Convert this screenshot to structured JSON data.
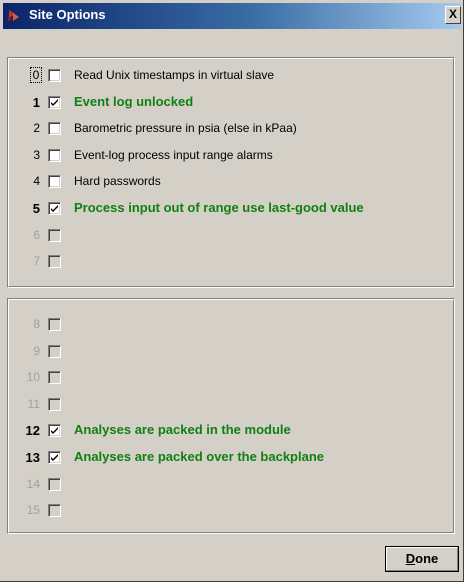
{
  "window": {
    "title": "Site Options",
    "close_label": "X"
  },
  "colors": {
    "enabled_label": "#108010",
    "disabled_number": "#a0a0a0",
    "titlebar_start": "#0a246a",
    "titlebar_end": "#a6caf0"
  },
  "options_top": [
    {
      "number": "0",
      "label": "Read Unix timestamps in virtual slave",
      "checked": false,
      "enabled": true
    },
    {
      "number": "1",
      "label": "Event log unlocked",
      "checked": true,
      "enabled": true
    },
    {
      "number": "2",
      "label": "Barometric pressure in psia (else in kPaa)",
      "checked": false,
      "enabled": true
    },
    {
      "number": "3",
      "label": "Event-log process input range alarms",
      "checked": false,
      "enabled": true
    },
    {
      "number": "4",
      "label": "Hard passwords",
      "checked": false,
      "enabled": true
    },
    {
      "number": "5",
      "label": "Process input out of range use last-good value",
      "checked": true,
      "enabled": true
    },
    {
      "number": "6",
      "label": "",
      "checked": false,
      "enabled": false
    },
    {
      "number": "7",
      "label": "",
      "checked": false,
      "enabled": false
    }
  ],
  "options_bottom": [
    {
      "number": "8",
      "label": "",
      "checked": false,
      "enabled": false
    },
    {
      "number": "9",
      "label": "",
      "checked": false,
      "enabled": false
    },
    {
      "number": "10",
      "label": "",
      "checked": false,
      "enabled": false
    },
    {
      "number": "11",
      "label": "",
      "checked": false,
      "enabled": false
    },
    {
      "number": "12",
      "label": "Analyses are packed in the module",
      "checked": true,
      "enabled": true
    },
    {
      "number": "13",
      "label": "Analyses are packed over the backplane",
      "checked": true,
      "enabled": true
    },
    {
      "number": "14",
      "label": "",
      "checked": false,
      "enabled": false
    },
    {
      "number": "15",
      "label": "",
      "checked": false,
      "enabled": false
    }
  ],
  "buttons": {
    "done_accel": "D",
    "done_rest": "one"
  }
}
